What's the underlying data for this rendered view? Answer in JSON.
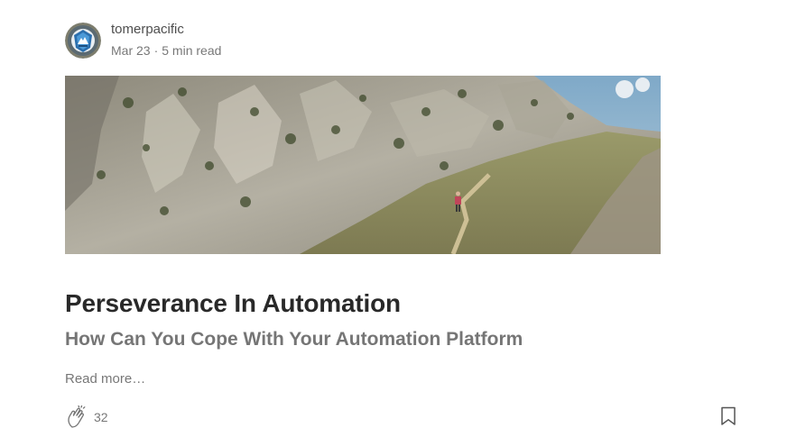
{
  "author": {
    "name": "tomerpacific",
    "date": "Mar 23",
    "separator": "·",
    "read_time": "5 min read"
  },
  "hero": {
    "icon": "mountain-hiker-image"
  },
  "post": {
    "title": "Perseverance In Automation",
    "subtitle": "How Can You Cope With Your Automation Platform",
    "read_more": "Read more…"
  },
  "footer": {
    "claps": "32",
    "clap_icon": "clap-icon",
    "bookmark_icon": "bookmark-icon"
  }
}
